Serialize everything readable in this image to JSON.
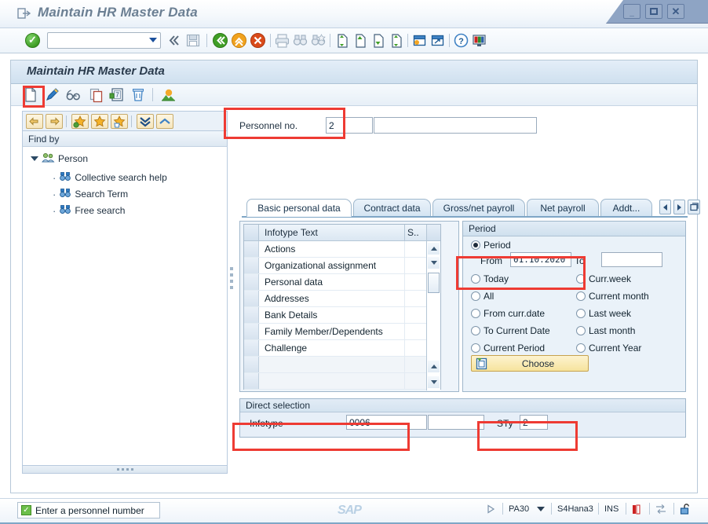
{
  "window": {
    "title": "Maintain HR Master Data",
    "title_icon": "exit-arrow-icon",
    "controls": {
      "minimize": "—",
      "maximize": "❐",
      "close": "×"
    }
  },
  "system_toolbar": {
    "ok_button": "enter-check-icon",
    "command_field": {
      "value": "",
      "placeholder": ""
    },
    "icons": [
      "back-double-icon",
      "save-icon",
      "back-green-icon",
      "exit-yellow-icon",
      "cancel-red-icon",
      "print-icon",
      "find-icon",
      "find-next-icon",
      "first-page-icon",
      "previous-page-icon",
      "next-page-icon",
      "last-page-icon",
      "create-session-icon",
      "shortcut-icon",
      "help-icon",
      "customize-layout-icon"
    ]
  },
  "screen": {
    "title": "Maintain HR Master Data",
    "app_toolbar": [
      {
        "name": "create-icon",
        "highlighted": true
      },
      {
        "name": "change-pencil-icon",
        "highlighted": false
      },
      {
        "name": "display-glasses-icon",
        "highlighted": false
      },
      {
        "name": "copy-icon",
        "highlighted": false
      },
      {
        "name": "overview-icon",
        "highlighted": false
      },
      {
        "name": "delete-trash-icon",
        "highlighted": false
      },
      {
        "name": "picture-icon",
        "highlighted": false
      }
    ]
  },
  "nav": {
    "toolbar_icons": [
      "back-arrow-icon",
      "forward-arrow-icon",
      "add-favorite-icon",
      "favorite-icon",
      "delete-favorite-icon",
      "expand-all-icon",
      "collapse-all-icon"
    ],
    "header": "Find by",
    "tree": {
      "root": {
        "label": "Person",
        "icon": "person-group-icon",
        "expanded": true
      },
      "children": [
        {
          "label": "Collective search help",
          "icon": "binoculars-icon"
        },
        {
          "label": "Search Term",
          "icon": "binoculars-icon"
        },
        {
          "label": "Free search",
          "icon": "binoculars-icon"
        }
      ]
    }
  },
  "personnel": {
    "label": "Personnel no.",
    "value": "2",
    "name_value": ""
  },
  "tabs": [
    {
      "label": "Basic personal data",
      "active": true
    },
    {
      "label": "Contract data",
      "active": false
    },
    {
      "label": "Gross/net payroll",
      "active": false
    },
    {
      "label": "Net payroll",
      "active": false
    },
    {
      "label": "Addt...",
      "active": false
    }
  ],
  "tab_nav": {
    "prev": "tab-scroll-left-icon",
    "next": "tab-scroll-right-icon",
    "list": "tab-list-icon"
  },
  "infotype_table": {
    "columns": [
      "Infotype Text",
      "S.."
    ],
    "rows": [
      {
        "text": "Actions",
        "s": ""
      },
      {
        "text": "Organizational assignment",
        "s": ""
      },
      {
        "text": "Personal data",
        "s": ""
      },
      {
        "text": "Addresses",
        "s": ""
      },
      {
        "text": "Bank Details",
        "s": ""
      },
      {
        "text": "Family Member/Dependents",
        "s": ""
      },
      {
        "text": "Challenge",
        "s": ""
      },
      {
        "text": "",
        "s": ""
      },
      {
        "text": "",
        "s": ""
      }
    ]
  },
  "period": {
    "title": "Period",
    "options_left": [
      {
        "label": "Period",
        "selected": true
      },
      {
        "label": "Today",
        "selected": false
      },
      {
        "label": "All",
        "selected": false
      },
      {
        "label": "From curr.date",
        "selected": false
      },
      {
        "label": "To Current Date",
        "selected": false
      },
      {
        "label": "Current Period",
        "selected": false
      }
    ],
    "options_right": [
      {
        "label": "Curr.week",
        "selected": false
      },
      {
        "label": "Current month",
        "selected": false
      },
      {
        "label": "Last week",
        "selected": false
      },
      {
        "label": "Last month",
        "selected": false
      },
      {
        "label": "Current Year",
        "selected": false
      }
    ],
    "from_label": "From",
    "from_value": "01.10.2020",
    "to_label": "To",
    "to_value": "",
    "choose_button": "Choose",
    "choose_icon": "choose-clipboard-icon"
  },
  "direct_selection": {
    "title": "Direct selection",
    "infotype_label": "Infotype",
    "infotype_value": "0006",
    "infotype_text": "",
    "sty_label": "STy",
    "sty_value": "2"
  },
  "status": {
    "message": "Enter a personnel number",
    "message_icon": "status-ok-icon",
    "sap_logo": "SAP",
    "transaction": "PA30",
    "system": "S4Hana3",
    "insert_mode": "INS",
    "icons": [
      "play-icon",
      "dropdown-arrow-icon",
      "signal-icon",
      "servers-icon",
      "lock-open-icon"
    ]
  },
  "colors": {
    "annotation": "#ee3b33",
    "accent": "#7fa6c6",
    "choose_button": "#f6e39d"
  }
}
